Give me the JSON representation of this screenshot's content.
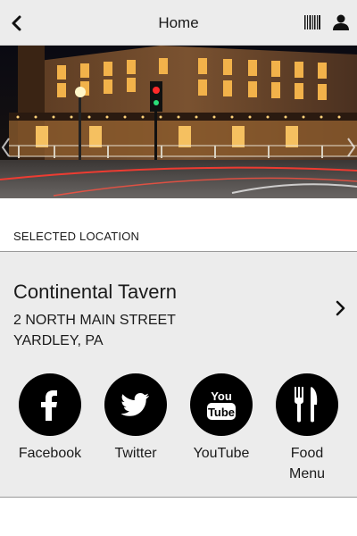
{
  "header": {
    "title": "Home",
    "back_icon": "chevron-left-icon",
    "barcode_icon": "barcode-icon",
    "user_icon": "user-icon"
  },
  "hero": {
    "image": "Continental Tavern building at night with holiday lights"
  },
  "section": {
    "label": "SELECTED LOCATION"
  },
  "location": {
    "name": "Continental Tavern",
    "address_line1": "2 NORTH MAIN STREET",
    "address_line2": "YARDLEY, PA"
  },
  "social": [
    {
      "label": "Facebook",
      "icon": "facebook-icon"
    },
    {
      "label": "Twitter",
      "icon": "twitter-icon"
    },
    {
      "label": "YouTube",
      "icon": "youtube-icon"
    },
    {
      "label": "Food Menu",
      "icon": "fork-knife-icon"
    }
  ],
  "colors": {
    "header_bg": "#ececec",
    "panel_bg": "#ececec",
    "icon_circle": "#000000",
    "text": "#1a1a1a"
  }
}
